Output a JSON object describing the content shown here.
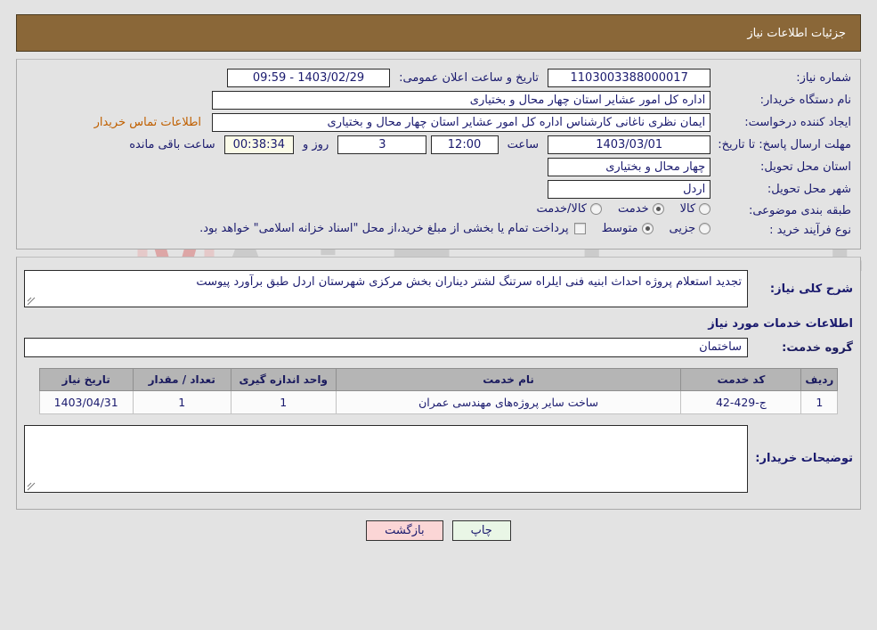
{
  "header": {
    "title": "جزئیات اطلاعات نیاز"
  },
  "watermark": {
    "text": "AriaTender.net",
    "shield_color": "#e8b4b4",
    "text_color": "#b9b9b9"
  },
  "colors": {
    "header_bg": "#8a6738",
    "header_text": "#ffffff",
    "label_text": "#1a1a6e",
    "link": "#c06000",
    "countdown_bg": "#fbfbe8",
    "table_header_bg": "#b5b5b5",
    "print_btn_bg": "#e9f6e6",
    "back_btn_bg": "#fbd6d6"
  },
  "form": {
    "need_number_label": "شماره نیاز:",
    "need_number_value": "1103003388000017",
    "announce_datetime_label": "تاریخ و ساعت اعلان عمومی:",
    "announce_datetime_value": "1403/02/29 - 09:59",
    "buyer_org_label": "نام دستگاه خریدار:",
    "buyer_org_value": "اداره کل امور عشایر استان چهار محال و بختیاری",
    "creator_label": "ایجاد کننده درخواست:",
    "creator_value": "ایمان نظری ناغانی کارشناس اداره کل امور عشایر استان چهار محال و بختیاری",
    "contact_link_label": "اطلاعات تماس خریدار",
    "deadline_label": "مهلت ارسال پاسخ: تا تاریخ:",
    "deadline_date": "1403/03/01",
    "hour_label": "ساعت",
    "deadline_time": "12:00",
    "days_value": "3",
    "days_label": "روز و",
    "countdown_value": "00:38:34",
    "remaining_label": "ساعت باقی مانده",
    "delivery_province_label": "استان محل تحویل:",
    "delivery_province_value": "چهار محال و بختیاری",
    "delivery_city_label": "شهر محل تحویل:",
    "delivery_city_value": "اردل",
    "classification_label": "طبقه بندی موضوعی:",
    "classification_options": [
      {
        "label": "کالا",
        "selected": false
      },
      {
        "label": "خدمت",
        "selected": true
      },
      {
        "label": "کالا/خدمت",
        "selected": false
      }
    ],
    "purchase_type_label": "نوع فرآیند خرید :",
    "purchase_type_options": [
      {
        "label": "جزیی",
        "selected": false
      },
      {
        "label": "متوسط",
        "selected": true
      }
    ],
    "treasury_checkbox_label": "پرداخت تمام یا بخشی از مبلغ خرید،از محل \"اسناد خزانه اسلامی\" خواهد بود.",
    "treasury_checkbox_checked": false
  },
  "description": {
    "label": "شرح کلی نیاز:",
    "value": "تجدید استعلام پروژه احداث ابنیه فنی ایلراه سرتنگ لشتر دیناران بخش مرکزی شهرستان اردل طبق برآورد پیوست"
  },
  "services_section": {
    "title": "اطلاعات خدمات مورد نیاز",
    "group_label": "گروه خدمت:",
    "group_value": "ساختمان"
  },
  "table": {
    "columns": [
      "ردیف",
      "کد خدمت",
      "نام خدمت",
      "واحد اندازه گیری",
      "تعداد / مقدار",
      "تاریخ نیاز"
    ],
    "rows": [
      {
        "radif": "1",
        "code": "ج-429-42",
        "name": "ساخت سایر پروژه‌های مهندسی عمران",
        "unit": "1",
        "qty": "1",
        "date": "1403/04/31"
      }
    ]
  },
  "buyer_notes": {
    "label": "توضیحات خریدار:",
    "value": "",
    "placeholder": ""
  },
  "footer": {
    "print_label": "چاپ",
    "back_label": "بازگشت"
  }
}
